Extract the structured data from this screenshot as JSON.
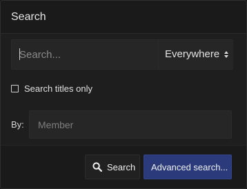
{
  "header": {
    "title": "Search"
  },
  "search": {
    "placeholder": "Search...",
    "value": "",
    "scope_selected": "Everywhere"
  },
  "options": {
    "titles_only_label": "Search titles only",
    "titles_only_checked": false
  },
  "by": {
    "label": "By:",
    "placeholder": "Member"
  },
  "footer": {
    "search_button_label": "Search",
    "search_button_icon": "search-icon",
    "advanced_button_label": "Advanced search..."
  },
  "colors": {
    "background": "#1e1e1e",
    "input_bg": "#262626",
    "accent": "#2a3a7a",
    "text": "#e6e6e6"
  }
}
